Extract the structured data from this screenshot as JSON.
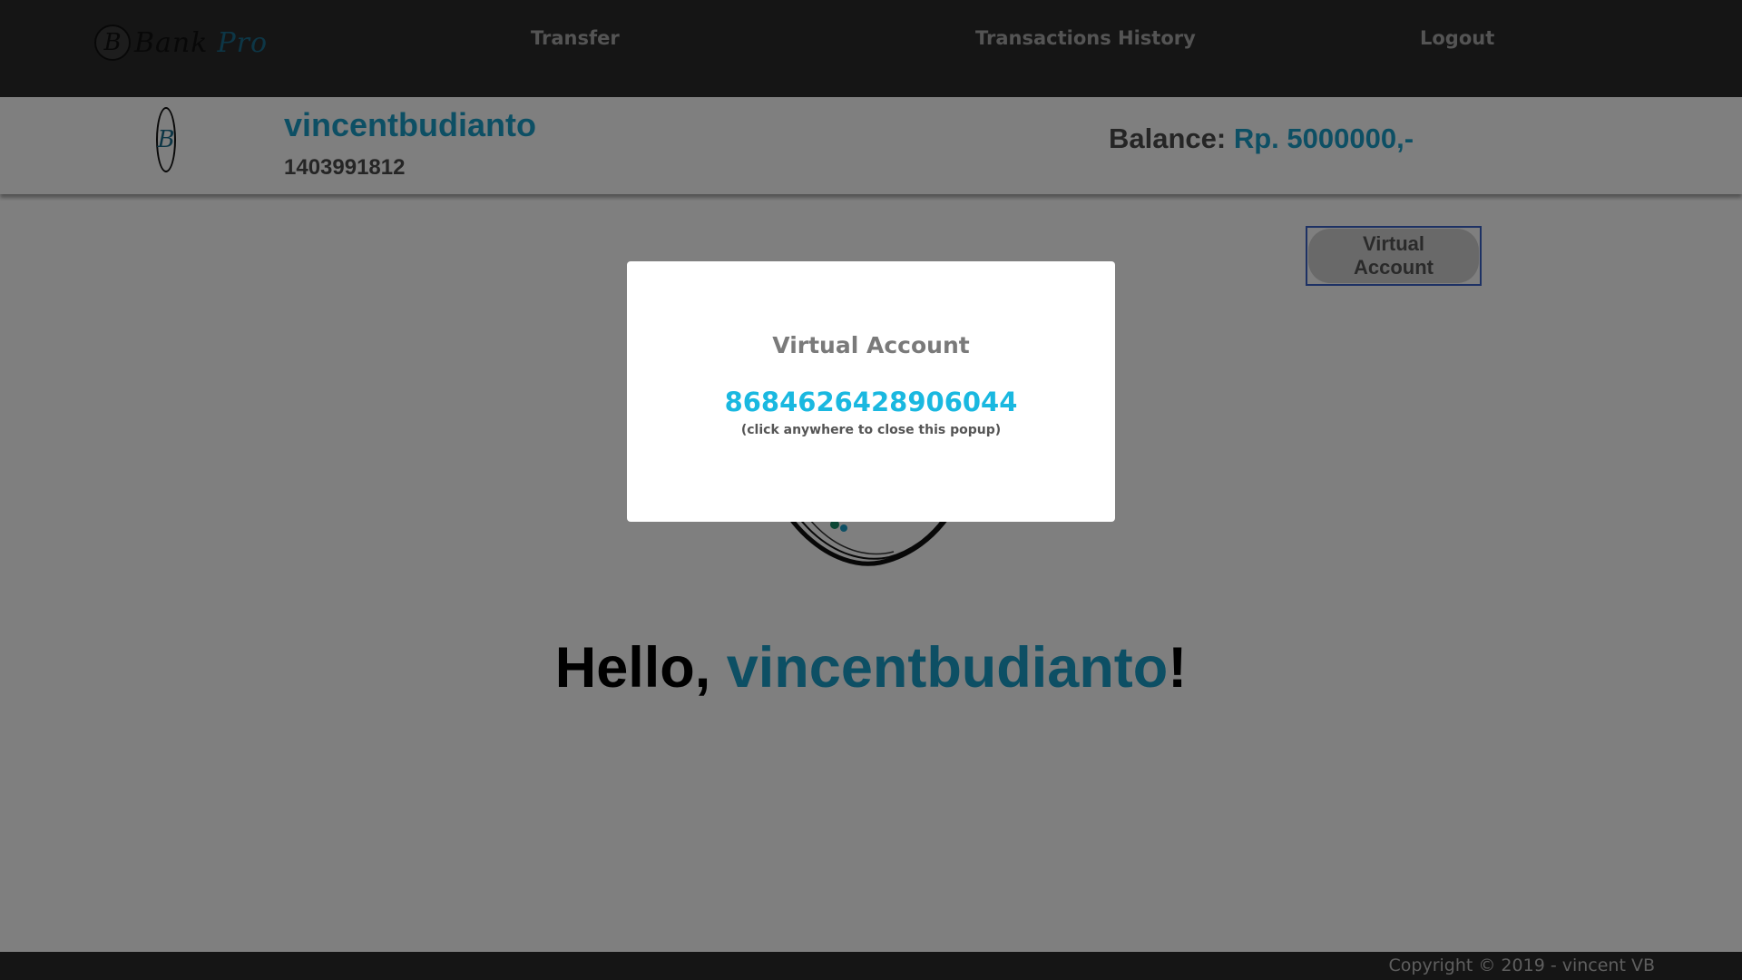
{
  "nav": {
    "logo_text_1": "Bank",
    "logo_text_2": "Pro",
    "logo_letter": "B",
    "links": [
      {
        "label": "Transfer"
      },
      {
        "label": "Transactions History"
      },
      {
        "label": "Logout"
      }
    ]
  },
  "profile": {
    "logo_letter": "B",
    "username": "vincentbudianto",
    "account_number": "1403991812",
    "balance_label": "Balance:",
    "balance_value": "Rp. 5000000,-"
  },
  "main": {
    "virtual_account_button": "Virtual Account",
    "greeting_prefix": "Hello, ",
    "greeting_name": "vincentbudianto",
    "greeting_suffix": "!"
  },
  "popup": {
    "title": "Virtual Account",
    "number": "8684626428906044",
    "hint": "(click anywhere to close this popup)"
  },
  "footer": {
    "copyright": "Copyright © 2019 - vincent VB"
  },
  "colors": {
    "accent": "#1b9fc9",
    "popup_number": "#1ab8e0",
    "topbar": "#2b2b2b"
  }
}
